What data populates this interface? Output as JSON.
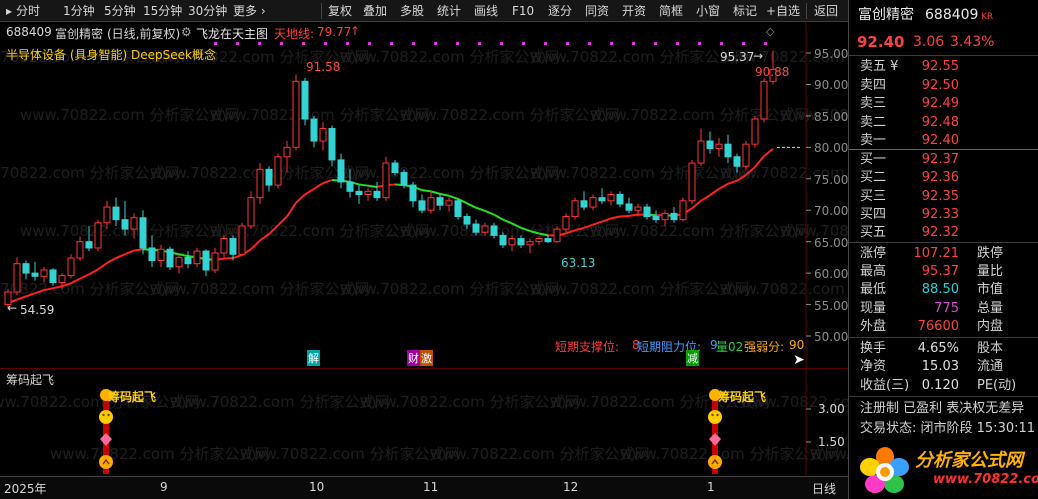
{
  "toolbar": {
    "items": [
      "分时",
      "1分钟",
      "5分钟",
      "15分钟",
      "30分钟",
      "更多 ›",
      "复权",
      "叠加",
      "多股",
      "统计",
      "画线",
      "F10",
      "逐分",
      "同资",
      "开资",
      "简框",
      "小窗",
      "标记",
      "+自选",
      "返回"
    ]
  },
  "main_chart": {
    "stock_code": "688409",
    "stock_name": "富创精密",
    "chart_mode": "(日线,前复权)",
    "indicator_name": "飞龙在天主图",
    "tiandi_label": "天地线:",
    "tiandi_value": "79.77",
    "tiandi_arrow": "↑",
    "overlay_text": "半导体设备 (具身智能) DeepSeek概念",
    "support_label": "短期支撑位:",
    "support_value": "8",
    "resistance_label": "短期阻力位:",
    "resistance_value": "9",
    "score_label": "强弱分:",
    "score_value": "90",
    "volume_label": "量02",
    "marker_jie": "解",
    "marker_cai": "财",
    "marker_ji": "激",
    "marker_jian": "减",
    "price_ticks": [
      "95.00",
      "90.00",
      "85.00",
      "80.00",
      "75.00",
      "70.00",
      "65.00",
      "60.00",
      "55.00",
      "50.00"
    ],
    "annotations": {
      "high_label": "91.58",
      "low_label": "63.13",
      "start_label": "54.59",
      "recent_high_label": "95.37",
      "recent_mark_label": "90.88"
    },
    "watermark_site": "www.70822.com",
    "watermark_cn": "分析家公式网"
  },
  "chart_data": {
    "type": "candlestick",
    "x_axis_labels": [
      "2025年",
      "9",
      "10",
      "11",
      "12",
      "1",
      "日线"
    ],
    "y_range": [
      50,
      96
    ],
    "candles": [
      [
        55.0,
        57.5,
        54.59,
        57.0
      ],
      [
        57.0,
        62.5,
        56.5,
        61.5
      ],
      [
        61.5,
        62.0,
        59.0,
        60.0
      ],
      [
        60.0,
        61.8,
        58.8,
        59.5
      ],
      [
        59.5,
        61.0,
        58.5,
        60.5
      ],
      [
        60.5,
        60.8,
        58.0,
        58.5
      ],
      [
        58.5,
        60.0,
        57.5,
        59.6
      ],
      [
        59.6,
        63.0,
        59.2,
        62.4
      ],
      [
        62.4,
        65.8,
        62.0,
        65.0
      ],
      [
        65.0,
        67.5,
        63.5,
        64.0
      ],
      [
        64.0,
        68.5,
        63.5,
        68.0
      ],
      [
        68.0,
        71.5,
        67.0,
        70.5
      ],
      [
        70.5,
        72.0,
        67.5,
        68.5
      ],
      [
        68.5,
        71.5,
        66.0,
        67.0
      ],
      [
        67.0,
        69.5,
        65.5,
        68.8
      ],
      [
        68.8,
        70.0,
        63.0,
        64.0
      ],
      [
        64.0,
        66.0,
        61.0,
        62.0
      ],
      [
        62.0,
        64.5,
        61.0,
        63.8
      ],
      [
        63.8,
        64.2,
        60.5,
        61.0
      ],
      [
        61.0,
        63.0,
        60.0,
        62.5
      ],
      [
        62.5,
        63.5,
        60.8,
        61.5
      ],
      [
        61.5,
        64.0,
        61.0,
        63.5
      ],
      [
        63.5,
        63.8,
        59.5,
        60.5
      ],
      [
        60.5,
        64.0,
        60.0,
        63.2
      ],
      [
        63.2,
        66.0,
        62.5,
        65.5
      ],
      [
        65.5,
        66.0,
        62.0,
        63.0
      ],
      [
        63.0,
        68.0,
        62.8,
        67.5
      ],
      [
        67.5,
        73.0,
        67.0,
        72.0
      ],
      [
        72.0,
        77.5,
        71.0,
        76.5
      ],
      [
        76.5,
        77.0,
        73.0,
        74.0
      ],
      [
        74.0,
        79.0,
        73.5,
        78.5
      ],
      [
        78.5,
        81.0,
        76.0,
        80.0
      ],
      [
        80.0,
        91.58,
        79.5,
        90.5
      ],
      [
        90.5,
        91.0,
        83.5,
        84.5
      ],
      [
        84.5,
        85.0,
        80.0,
        81.0
      ],
      [
        81.0,
        84.0,
        79.5,
        83.0
      ],
      [
        83.0,
        83.5,
        77.0,
        78.0
      ],
      [
        78.0,
        79.0,
        73.5,
        74.5
      ],
      [
        74.5,
        76.5,
        72.0,
        73.0
      ],
      [
        73.0,
        74.0,
        71.0,
        72.5
      ],
      [
        72.5,
        73.5,
        71.5,
        73.0
      ],
      [
        73.0,
        74.5,
        71.5,
        72.0
      ],
      [
        72.0,
        78.5,
        71.5,
        77.5
      ],
      [
        77.5,
        78.0,
        75.5,
        76.0
      ],
      [
        76.0,
        76.5,
        73.5,
        74.0
      ],
      [
        74.0,
        74.5,
        70.5,
        71.5
      ],
      [
        71.5,
        72.5,
        69.5,
        70.0
      ],
      [
        70.0,
        73.0,
        69.5,
        72.0
      ],
      [
        72.0,
        72.5,
        70.0,
        70.8
      ],
      [
        70.8,
        72.0,
        69.8,
        71.5
      ],
      [
        71.5,
        71.8,
        68.5,
        69.0
      ],
      [
        69.0,
        69.5,
        67.0,
        67.8
      ],
      [
        67.8,
        68.5,
        66.0,
        66.5
      ],
      [
        66.5,
        68.0,
        66.0,
        67.5
      ],
      [
        67.5,
        68.0,
        65.5,
        66.0
      ],
      [
        66.0,
        66.5,
        64.0,
        64.5
      ],
      [
        64.5,
        66.0,
        63.5,
        65.5
      ],
      [
        65.5,
        66.0,
        64.0,
        64.5
      ],
      [
        64.5,
        65.5,
        63.13,
        65.0
      ],
      [
        65.0,
        65.8,
        64.5,
        65.5
      ],
      [
        65.5,
        66.0,
        64.8,
        65.0
      ],
      [
        65.0,
        67.5,
        64.8,
        67.0
      ],
      [
        67.0,
        69.5,
        66.5,
        69.0
      ],
      [
        69.0,
        72.0,
        68.5,
        71.5
      ],
      [
        71.5,
        73.0,
        70.0,
        70.5
      ],
      [
        70.5,
        72.5,
        70.0,
        72.0
      ],
      [
        72.0,
        73.5,
        71.0,
        71.5
      ],
      [
        71.5,
        73.0,
        70.8,
        72.5
      ],
      [
        72.5,
        73.0,
        70.5,
        71.0
      ],
      [
        71.0,
        72.0,
        69.5,
        70.0
      ],
      [
        70.0,
        71.0,
        69.0,
        70.5
      ],
      [
        70.5,
        71.0,
        68.5,
        69.0
      ],
      [
        69.0,
        70.0,
        68.0,
        68.5
      ],
      [
        68.5,
        70.0,
        67.5,
        69.5
      ],
      [
        69.5,
        70.5,
        68.0,
        68.5
      ],
      [
        68.5,
        72.0,
        68.2,
        71.5
      ],
      [
        71.5,
        78.0,
        71.0,
        77.5
      ],
      [
        77.5,
        83.0,
        77.0,
        81.0
      ],
      [
        81.0,
        82.5,
        79.0,
        79.8
      ],
      [
        79.8,
        81.5,
        78.5,
        80.5
      ],
      [
        80.5,
        82.0,
        77.5,
        78.5
      ],
      [
        78.5,
        79.0,
        76.0,
        77.0
      ],
      [
        77.0,
        81.0,
        76.5,
        80.5
      ],
      [
        80.5,
        85.0,
        80.0,
        84.5
      ],
      [
        84.5,
        91.0,
        84.0,
        90.5
      ],
      [
        90.5,
        95.37,
        90.0,
        92.4
      ]
    ],
    "ma_values": [
      55.2,
      55.8,
      56.3,
      56.8,
      57.3,
      57.6,
      57.9,
      58.4,
      59.1,
      59.8,
      60.6,
      61.6,
      62.4,
      63.0,
      63.6,
      63.8,
      63.7,
      63.6,
      63.3,
      63.0,
      62.7,
      62.5,
      62.2,
      62.1,
      62.3,
      62.4,
      62.9,
      63.8,
      65.2,
      66.2,
      67.6,
      69.0,
      71.2,
      72.5,
      73.4,
      74.3,
      74.8,
      74.7,
      74.5,
      74.1,
      73.9,
      73.7,
      74.0,
      74.1,
      74.0,
      73.7,
      73.2,
      73.0,
      72.6,
      72.3,
      71.8,
      71.1,
      70.4,
      69.9,
      69.3,
      68.5,
      67.9,
      67.2,
      66.7,
      66.3,
      66.0,
      66.0,
      66.3,
      66.8,
      67.2,
      67.7,
      68.2,
      68.7,
      69.0,
      69.1,
      69.3,
      69.3,
      69.2,
      69.2,
      69.1,
      69.4,
      70.3,
      71.5,
      72.4,
      73.4,
      74.2,
      74.7,
      75.6,
      76.9,
      78.6,
      79.77
    ]
  },
  "sub_chart": {
    "title": "筹码起飞",
    "signal_label": "筹码起飞",
    "ticks": [
      "3.00",
      "1.50"
    ]
  },
  "quote": {
    "name": "富创精密",
    "code": "688409",
    "badge": "KR",
    "price": "92.40",
    "change": "3.06",
    "change_pct": "3.43%",
    "asks": [
      {
        "label": "卖五 ¥",
        "price": "92.55"
      },
      {
        "label": "卖四",
        "price": "92.50"
      },
      {
        "label": "卖三",
        "price": "92.49"
      },
      {
        "label": "卖二",
        "price": "92.48"
      },
      {
        "label": "卖一",
        "price": "92.40"
      }
    ],
    "bids": [
      {
        "label": "买一",
        "price": "92.37"
      },
      {
        "label": "买二",
        "price": "92.36"
      },
      {
        "label": "买三",
        "price": "92.35"
      },
      {
        "label": "买四",
        "price": "92.33"
      },
      {
        "label": "买五",
        "price": "92.32"
      }
    ],
    "stats": [
      {
        "label": "涨停",
        "value": "107.21",
        "label2": "跌停"
      },
      {
        "label": "最高",
        "value": "95.37",
        "label2": "量比"
      },
      {
        "label": "最低",
        "value": "88.50",
        "label2": "市值"
      },
      {
        "label": "现量",
        "value": "775",
        "label2": "总量"
      },
      {
        "label": "外盘",
        "value": "76600",
        "label2": "内盘"
      }
    ],
    "fin": [
      {
        "label": "换手",
        "value": "4.65%",
        "label2": "股本"
      },
      {
        "label": "净资",
        "value": "15.03",
        "label2": "流通"
      },
      {
        "label": "收益(三)",
        "value": "0.120",
        "label2": "PE(动)"
      }
    ],
    "notes": {
      "reg": "注册制 已盈利 表决权无差异",
      "status": "交易状态: 闭市阶段 15:30:11"
    },
    "logo_text": "分析家公式网",
    "logo_url": "www.70822.com"
  },
  "colors": {
    "up": "#ff3232",
    "down": "#34d3d3",
    "ma_up": "#ff2020",
    "ma_down": "#22e022",
    "axis": "#8c8c8c",
    "accent_bar": "#0a64c8"
  }
}
